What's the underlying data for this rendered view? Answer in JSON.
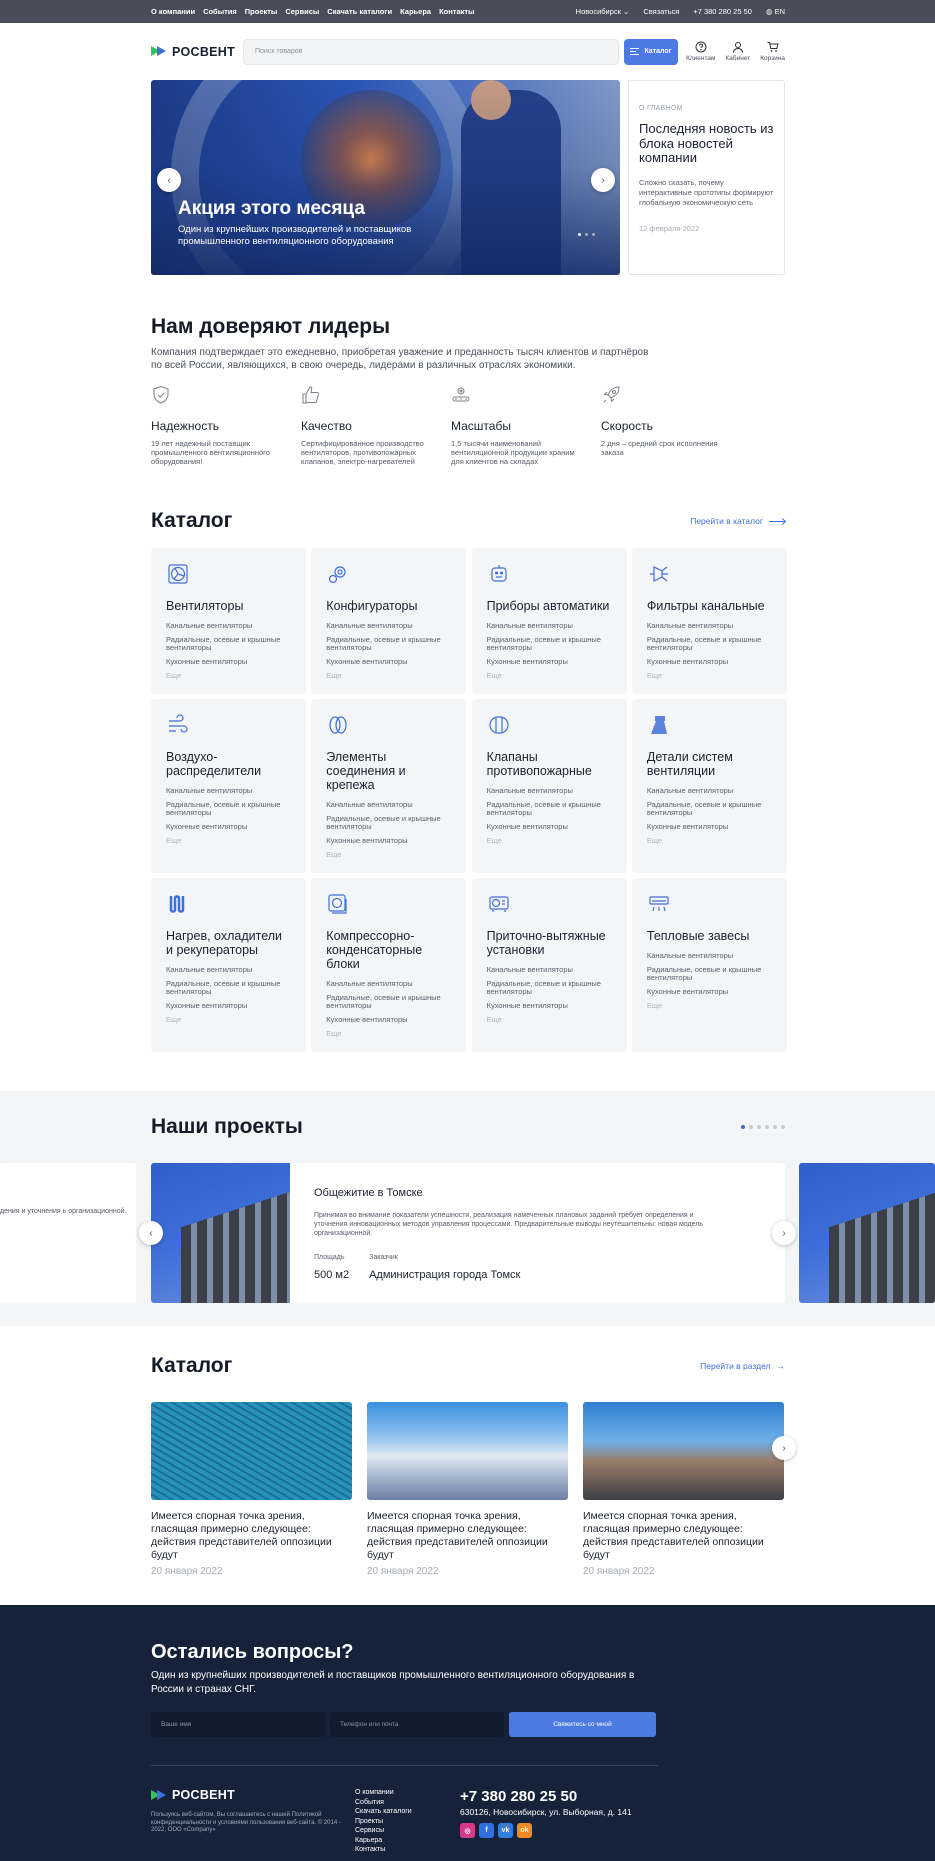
{
  "topbar": {
    "nav": [
      "О компании",
      "События",
      "Проекты",
      "Сервисы",
      "Скачать каталоги",
      "Карьера",
      "Контакты"
    ],
    "city": "Новосибирск",
    "contact": "Связаться",
    "phone": "+7 380 280 25 50",
    "lang": "EN"
  },
  "header": {
    "logo": "РОСВЕНТ",
    "search_placeholder": "Поиск товаров",
    "catalog_label": "Каталог",
    "icons": [
      {
        "label": "Клиентам",
        "icon": "help-icon"
      },
      {
        "label": "Кабинет",
        "icon": "user-icon"
      },
      {
        "label": "Корзина",
        "icon": "cart-icon"
      }
    ]
  },
  "hero": {
    "title": "Акция этого месяца",
    "subtitle": "Один из крупнейших производителей и поставщиков промышленного вентиляционного оборудования"
  },
  "news": {
    "kicker": "О главном",
    "title": "Последняя новость из блока новостей компании",
    "text": "Сложно сказать, почему интерактивные прототипы формируют глобальную экономическую сеть",
    "date": "12 февраля 2022"
  },
  "trust": {
    "title": "Нам доверяют лидеры",
    "lead": "Компания подтверждает это ежедневно, приобретая уважение и преданность тысяч клиентов и партнёров по всей России, являющихся, в свою очередь, лидерами в различных отраслях экономики.",
    "features": [
      {
        "title": "Надежность",
        "text": "19 лет надежный поставщик промышленного вентиляционного оборудования!"
      },
      {
        "title": "Качество",
        "text": "Сертифицированное производство вентиляторов, противопожарных клапанов, электро-нагревателей"
      },
      {
        "title": "Масштабы",
        "text": "1,5 тысячи наименований вентиляционной продукции храним для клиентов на складах"
      },
      {
        "title": "Скорость",
        "text": "2 дня – средний срок исполнения заказа"
      }
    ]
  },
  "catalog": {
    "title": "Каталог",
    "link": "Перейти в каталог",
    "sub1": "Канальные вентиляторы",
    "sub2": "Радиальные, осевые и крышные вентиляторы",
    "sub3": "Кухонные вентиляторы",
    "more": "Еще",
    "items": [
      "Вентиляторы",
      "Конфигураторы",
      "Приборы автоматики",
      "Фильтры канальные",
      "Воздухо-распределители",
      "Элементы соединения и крепежа",
      "Клапаны противопожарные",
      "Детали систем вентиляции",
      "Нагрев, охладители и рекуператоры",
      "Компрессорно-конденсаторные блоки",
      "Приточно-вытяжные установки",
      "Тепловые завесы"
    ]
  },
  "projects": {
    "title": "Наши проекты",
    "card": {
      "title": "Общежитие в Томске",
      "text": "Принимая во внимание показатели успешности, реализация намеченных плановых заданий требует определения и уточнения инновационных методов управления процессами. Предварительные выводы неутешительны: новая модель организационной.",
      "area_label": "Площадь",
      "area": "500 м2",
      "client_label": "Заказчик",
      "client": "Администрация города Томск"
    },
    "peek_text": "дения и уточнения ь организационной."
  },
  "articles": {
    "title": "Каталог",
    "link": "Перейти в раздел",
    "items": [
      {
        "title": "Имеется спорная точка зрения, гласящая примерно следующее: действия представителей оппозиции будут",
        "date": "20 января 2022"
      },
      {
        "title": "Имеется спорная точка зрения, гласящая примерно следующее: действия представителей оппозиции будут",
        "date": "20 января 2022"
      },
      {
        "title": "Имеется спорная точка зрения, гласящая примерно следующее: действия представителей оппозиции будут",
        "date": "20 января 2022"
      }
    ]
  },
  "footer": {
    "title": "Остались вопросы?",
    "text": "Один из крупнейших производителей и поставщиков промышленного вентиляционного оборудования в России и странах СНГ.",
    "name_placeholder": "Ваше имя",
    "contact_placeholder": "Телефон или почта",
    "submit": "Свяжитесь со мной",
    "logo": "РОСВЕНТ",
    "legal": "Пользуясь веб-сайтом, Вы соглашаетесь с нашей Политикой конфиденциальности и условиями пользования веб-сайта. © 2014 - 2022, ООО «Company»",
    "links": [
      "О компании",
      "События",
      "Скачать каталоги",
      "Проекты",
      "Сервисы",
      "Карьера",
      "Контакты"
    ],
    "phone": "+7 380 280 25 50",
    "address": "630126, Новосибирск, ул. Выборная, д. 141",
    "socials": [
      {
        "name": "instagram-icon",
        "glyph": "◎",
        "color": "#d63a8a"
      },
      {
        "name": "facebook-icon",
        "glyph": "f",
        "color": "#2f6fe0"
      },
      {
        "name": "vk-icon",
        "glyph": "vk",
        "color": "#2f7fe0"
      },
      {
        "name": "odnoklassniki-icon",
        "glyph": "ok",
        "color": "#f08a24"
      }
    ]
  },
  "colors": {
    "accent": "#4d7ae0",
    "topbar": "#474e59",
    "footer": "#16213a"
  }
}
